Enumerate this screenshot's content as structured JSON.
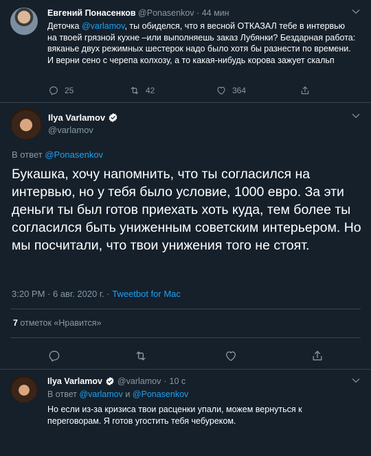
{
  "colors": {
    "background": "#15202b",
    "accent": "#1da1f2",
    "muted": "#8899a6",
    "border": "#38444d"
  },
  "tweet1": {
    "author_name": "Евгений Понасенков",
    "handle": "@Ponasenkov",
    "dot": "·",
    "time": "44 мин",
    "text_part1": "Деточка ",
    "mention": "@varlamov",
    "text_part2": ", ты обиделся, что я весной ОТКАЗАЛ тебе в интервью на твоей грязной кухне –или выполняешь заказ Лубянки? Бездарная работа: вяканье двух режимных шестерок надо было хотя бы разнести по времени. И верни сено с черепа колхозу, а то какая-нибудь корова зажует скальп",
    "reply_count": "25",
    "retweet_count": "42",
    "like_count": "364"
  },
  "main_tweet": {
    "author_name": "Ilya Varlamov",
    "handle": "@varlamov",
    "reply_prefix": "В ответ ",
    "reply_to": "@Ponasenkov",
    "text": "Букашка, хочу напомнить, что ты согласился на интервью, но у тебя было условие, 1000 евро. За эти деньги ты был готов приехать хоть куда, тем более ты согласился быть униженным советским интерьером. Но мы посчитали, что твои унижения того не стоят.",
    "time": "3:20 PM",
    "dot": " · ",
    "date": "6 авг. 2020 г.",
    "source": "Tweetbot for Mac",
    "likes_count": "7",
    "likes_label": " отметок «Нравится»"
  },
  "reply_tweet": {
    "author_name": "Ilya Varlamov",
    "handle": "@varlamov",
    "dot": "·",
    "time": "10 с",
    "reply_prefix": "В ответ ",
    "reply_to_1": "@varlamov",
    "reply_and": " и ",
    "reply_to_2": "@Ponasenkov",
    "text": "Но если из-за кризиса твои расценки упали, можем вернуться к переговорам. Я готов угостить тебя чебуреком."
  }
}
